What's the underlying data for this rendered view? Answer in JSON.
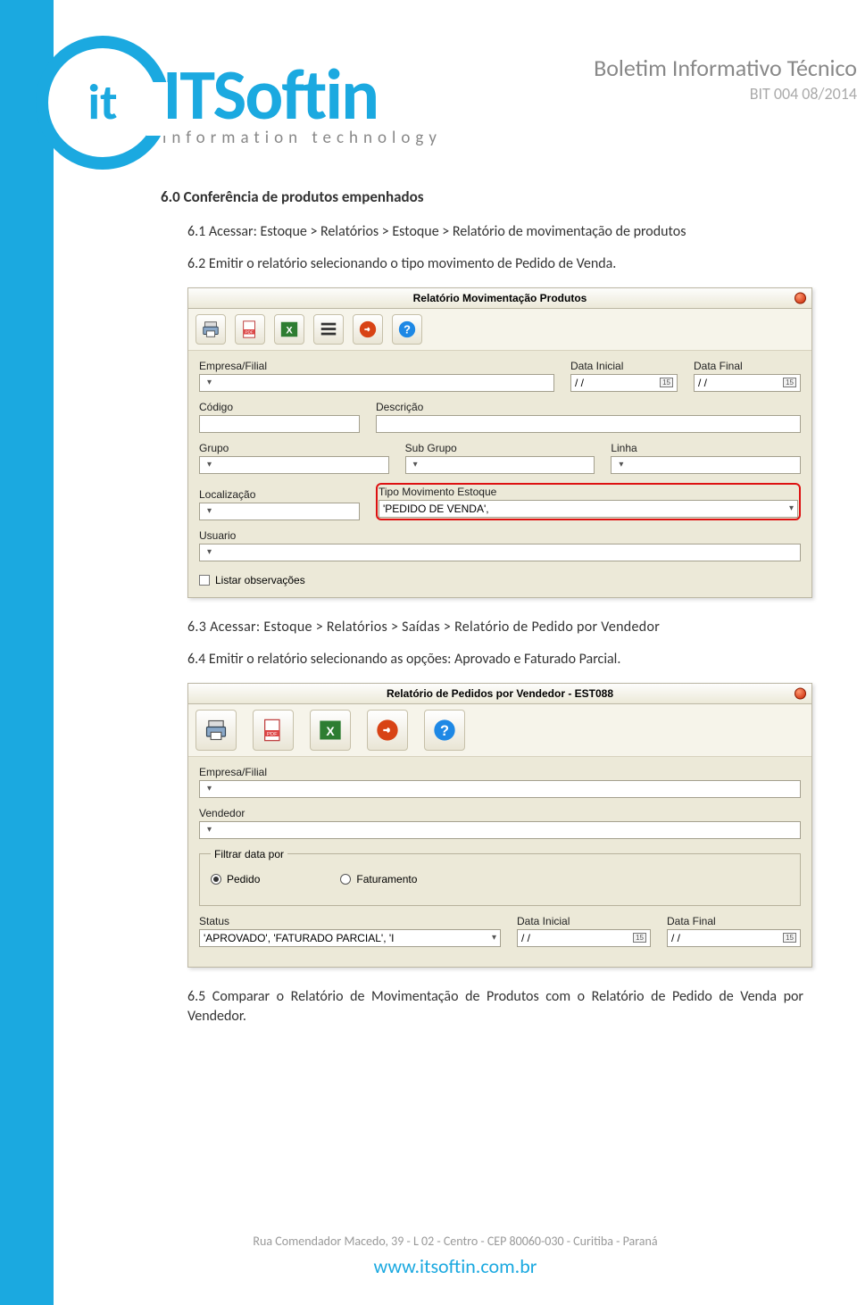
{
  "header": {
    "logo_main": "ITSoftin",
    "logo_sub": "information technology",
    "logo_inner": "it",
    "title": "Boletim Informativo Técnico",
    "code": "BIT 004 08/2014"
  },
  "section": {
    "title": "6.0 Conferência de produtos empenhados",
    "steps": {
      "s1": "6.1 Acessar: Estoque > Relatórios > Estoque > Relatório de movimentação de produtos",
      "s2": "6.2 Emitir o relatório selecionando o tipo movimento de Pedido de Venda.",
      "s3": "6.3 Acessar: Estoque > Relatórios > Saídas > Relatório de Pedido por Vendedor",
      "s4": "6.4 Emitir o relatório selecionando as opções: Aprovado e Faturado Parcial.",
      "s5": "6.5 Comparar o Relatório de Movimentação de Produtos com o Relatório de Pedido de Venda por Vendedor."
    }
  },
  "win1": {
    "title": "Relatório Movimentação Produtos",
    "labels": {
      "empresa": "Empresa/Filial",
      "data_inicial": "Data Inicial",
      "data_final": "Data Final",
      "codigo": "Código",
      "descricao": "Descrição",
      "grupo": "Grupo",
      "subgrupo": "Sub Grupo",
      "linha": "Linha",
      "localizacao": "Localização",
      "tipo_mov": "Tipo Movimento Estoque",
      "usuario": "Usuario",
      "listar_obs": "Listar observações"
    },
    "values": {
      "data_inicial": "/  /",
      "data_final": "/  /",
      "tipo_mov": "'PEDIDO DE VENDA',"
    }
  },
  "win2": {
    "title": "Relatório de Pedidos por Vendedor - EST088",
    "labels": {
      "empresa": "Empresa/Filial",
      "vendedor": "Vendedor",
      "filtrar": "Filtrar data por",
      "pedido": "Pedido",
      "faturamento": "Faturamento",
      "status": "Status",
      "data_inicial": "Data Inicial",
      "data_final": "Data Final"
    },
    "values": {
      "status": "'APROVADO', 'FATURADO PARCIAL', 'I",
      "data_inicial": "/  /",
      "data_final": "/  /"
    }
  },
  "footer": {
    "address": "Rua Comendador Macedo, 39 - L 02 - Centro - CEP 80060-030 - Curitiba - Paraná",
    "url": "www.itsoftin.com.br"
  },
  "icons": {
    "printer": "printer-icon",
    "pdf": "pdf-icon",
    "excel": "excel-icon",
    "list": "list-icon",
    "arrow": "arrow-icon",
    "help": "help-icon"
  }
}
